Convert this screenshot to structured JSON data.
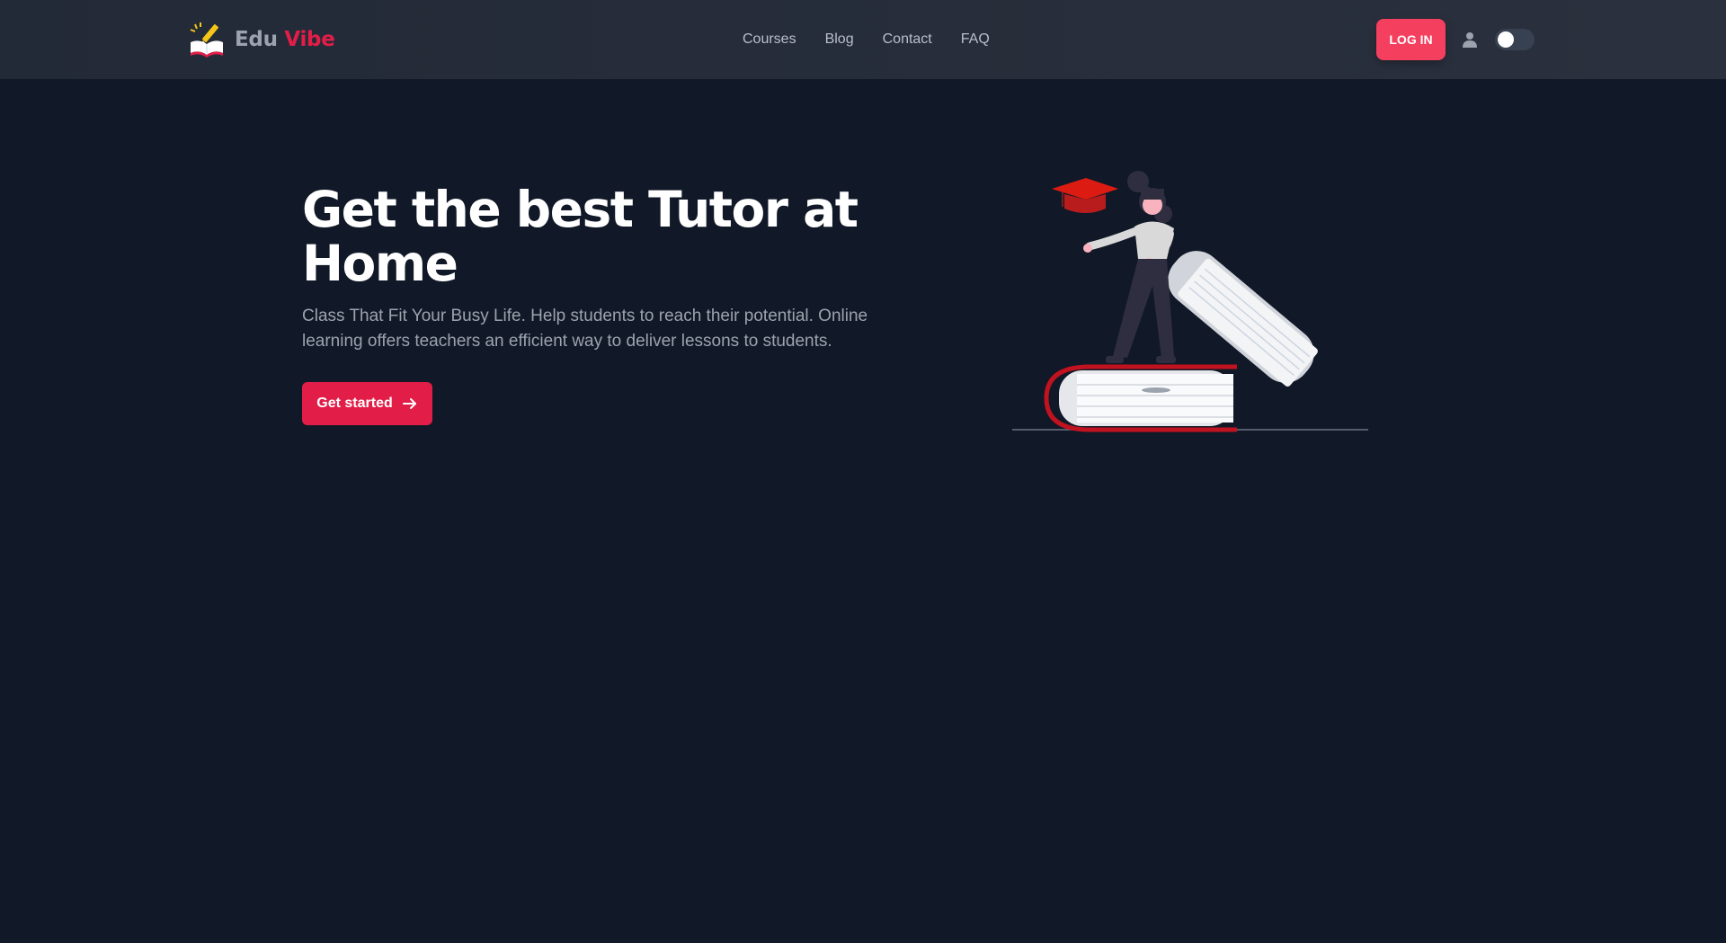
{
  "header": {
    "brand": {
      "part1": "Edu",
      "part2": "Vibe",
      "logo_icon": "book-pencil-icon"
    },
    "nav": [
      {
        "label": "Courses"
      },
      {
        "label": "Blog"
      },
      {
        "label": "Contact"
      },
      {
        "label": "FAQ"
      }
    ],
    "login_label": "LOG IN",
    "user_icon": "user-icon",
    "theme_toggle": {
      "on": false
    }
  },
  "hero": {
    "title": "Get the best Tutor at Home",
    "subtitle": "Class That Fit Your Busy Life. Help students to reach their potential. Online learning offers teachers an efficient way to deliver lessons to students.",
    "cta_label": "Get started",
    "cta_icon": "arrow-right-icon",
    "illustration": "student-with-books-illustration"
  },
  "colors": {
    "page_background": "#111827",
    "header_background": "#262c38",
    "accent": "#e11d48",
    "login_button": "#f43f5e",
    "muted_text": "#9ca3af"
  }
}
